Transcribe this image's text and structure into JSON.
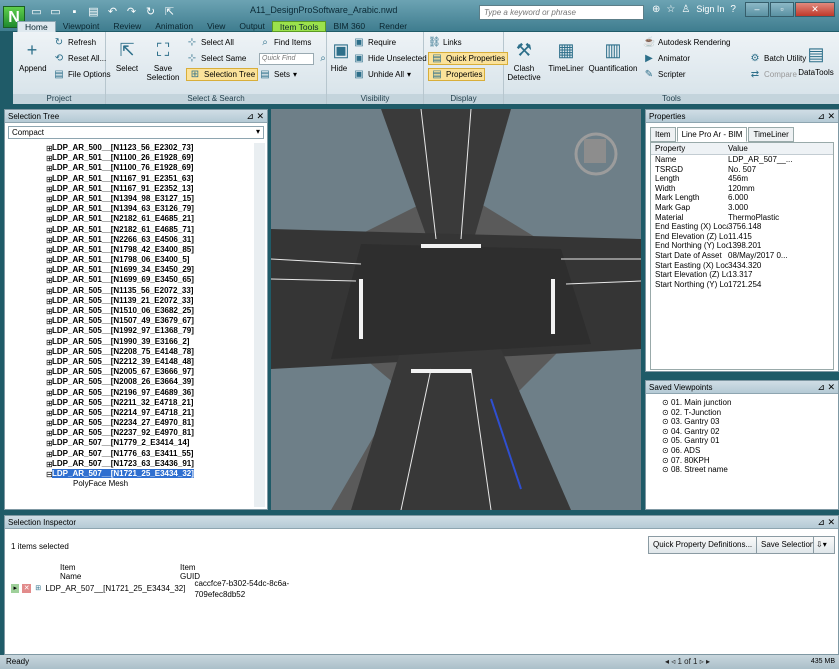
{
  "titlebar": {
    "logo": "N",
    "document_title": "A11_DesignProSoftware_Arabic.nwd",
    "search_placeholder": "Type a keyword or phrase",
    "sign_in": "Sign In"
  },
  "ribbon_tabs": [
    "Home",
    "Viewpoint",
    "Review",
    "Animation",
    "View",
    "Output",
    "Item Tools",
    "BIM 360",
    "Render"
  ],
  "ribbon": {
    "project": {
      "label": "Project",
      "append": "Append",
      "refresh": "Refresh",
      "reset_all": "Reset All...",
      "file_options": "File Options"
    },
    "select_search": {
      "label": "Select & Search",
      "select": "Select",
      "save_selection": "Save Selection",
      "select_all": "Select All",
      "select_same": "Select Same",
      "selection_tree": "Selection Tree",
      "find_items": "Find Items",
      "quick_find_placeholder": "Quick Find",
      "sets": "Sets"
    },
    "visibility": {
      "label": "Visibility",
      "hide": "Hide",
      "require": "Require",
      "hide_unselected": "Hide Unselected",
      "unhide_all": "Unhide All"
    },
    "display": {
      "label": "Display",
      "links": "Links",
      "quick_properties": "Quick Properties",
      "properties": "Properties"
    },
    "tools": {
      "label": "Tools",
      "clash_detective": "Clash Detective",
      "timeliner": "TimeLiner",
      "quantification": "Quantification",
      "autodesk_rendering": "Autodesk Rendering",
      "animator": "Animator",
      "scripter": "Scripter",
      "batch_utility": "Batch Utility",
      "compare": "Compare",
      "datatools": "DataTools"
    }
  },
  "selection_tree": {
    "title": "Selection Tree",
    "mode": "Compact",
    "items": [
      "LDP_AR_500__[N1123_56_E2302_73]",
      "LDP_AR_501__[N1100_26_E1928_69]",
      "LDP_AR_501__[N1100_76_E1928_69]",
      "LDP_AR_501__[N1167_91_E2351_63]",
      "LDP_AR_501__[N1167_91_E2352_13]",
      "LDP_AR_501__[N1394_98_E3127_15]",
      "LDP_AR_501__[N1394_63_E3126_79]",
      "LDP_AR_501__[N2182_61_E4685_21]",
      "LDP_AR_501__[N2182_61_E4685_71]",
      "LDP_AR_501__[N2266_63_E4506_31]",
      "LDP_AR_501__[N1798_42_E3400_85]",
      "LDP_AR_501__[N1798_06_E3400_5]",
      "LDP_AR_501__[N1699_34_E3450_29]",
      "LDP_AR_501__[N1699_69_E3450_65]",
      "LDP_AR_505__[N1135_56_E2072_33]",
      "LDP_AR_505__[N1139_21_E2072_33]",
      "LDP_AR_505__[N1510_06_E3682_25]",
      "LDP_AR_505__[N1507_49_E3679_67]",
      "LDP_AR_505__[N1992_97_E1368_79]",
      "LDP_AR_505__[N1990_39_E3166_2]",
      "LDP_AR_505__[N2208_75_E4148_78]",
      "LDP_AR_505__[N2212_39_E4148_48]",
      "LDP_AR_505__[N2005_67_E3666_97]",
      "LDP_AR_505__[N2008_26_E3664_39]",
      "LDP_AR_505__[N2196_97_E4689_36]",
      "LDP_AR_505__[N2211_32_E4718_21]",
      "LDP_AR_505__[N2214_97_E4718_21]",
      "LDP_AR_505__[N2234_27_E4970_81]",
      "LDP_AR_505__[N2237_92_E4970_81]",
      "LDP_AR_507__[N1779_2_E3414_14]",
      "LDP_AR_507__[N1776_63_E3411_55]",
      "LDP_AR_507__[N1723_63_E3436_91]",
      "LDP_AR_507__[N1721_25_E3434_32]"
    ],
    "child_item": "PolyFace Mesh"
  },
  "properties": {
    "title": "Properties",
    "tabs": [
      "Item",
      "Line Pro Ar - BIM",
      "TimeLiner"
    ],
    "col_property": "Property",
    "col_value": "Value",
    "rows": [
      [
        "Name",
        "LDP_AR_507__..."
      ],
      [
        "TSRGD",
        "No. 507"
      ],
      [
        "Length",
        "456m"
      ],
      [
        "Width",
        "120mm"
      ],
      [
        "Mark Length",
        "6.000"
      ],
      [
        "Mark Gap",
        "3.000"
      ],
      [
        "Material",
        "ThermoPlastic"
      ],
      [
        "End Easting (X) Local",
        "3756.148"
      ],
      [
        "End Elevation (Z) Local",
        "11.415"
      ],
      [
        "End Northing (Y) Local",
        "1398.201"
      ],
      [
        "Start Date of Asset",
        "08/May/2017 0..."
      ],
      [
        "Start Easting (X) Local",
        "3434.320"
      ],
      [
        "Start Elevation (Z) Local",
        "13.317"
      ],
      [
        "Start Northing (Y) Local",
        "1721.254"
      ]
    ]
  },
  "saved_viewpoints": {
    "title": "Saved Viewpoints",
    "items": [
      "01. Main junction",
      "02. T-Junction",
      "03. Gantry 03",
      "04. Gantry 02",
      "05. Gantry 01",
      "06. ADS",
      "07. 80KPH",
      "08. Street name"
    ]
  },
  "selection_inspector": {
    "title": "Selection Inspector",
    "count": "1 items selected",
    "quick_property_btn": "Quick Property Definitions...",
    "save_selection_btn": "Save Selection",
    "col_item_name_1": "Item",
    "col_item_name_2": "Name",
    "col_item_guid_1": "Item",
    "col_item_guid_2": "GUID",
    "row_name": "LDP_AR_507__[N1721_25_E3434_32]",
    "row_guid": "caccfce7-b302-54dc-8c6a-709efec8db52"
  },
  "status": {
    "text": "Ready",
    "page": "1 of 1",
    "memory": "435 MB"
  }
}
